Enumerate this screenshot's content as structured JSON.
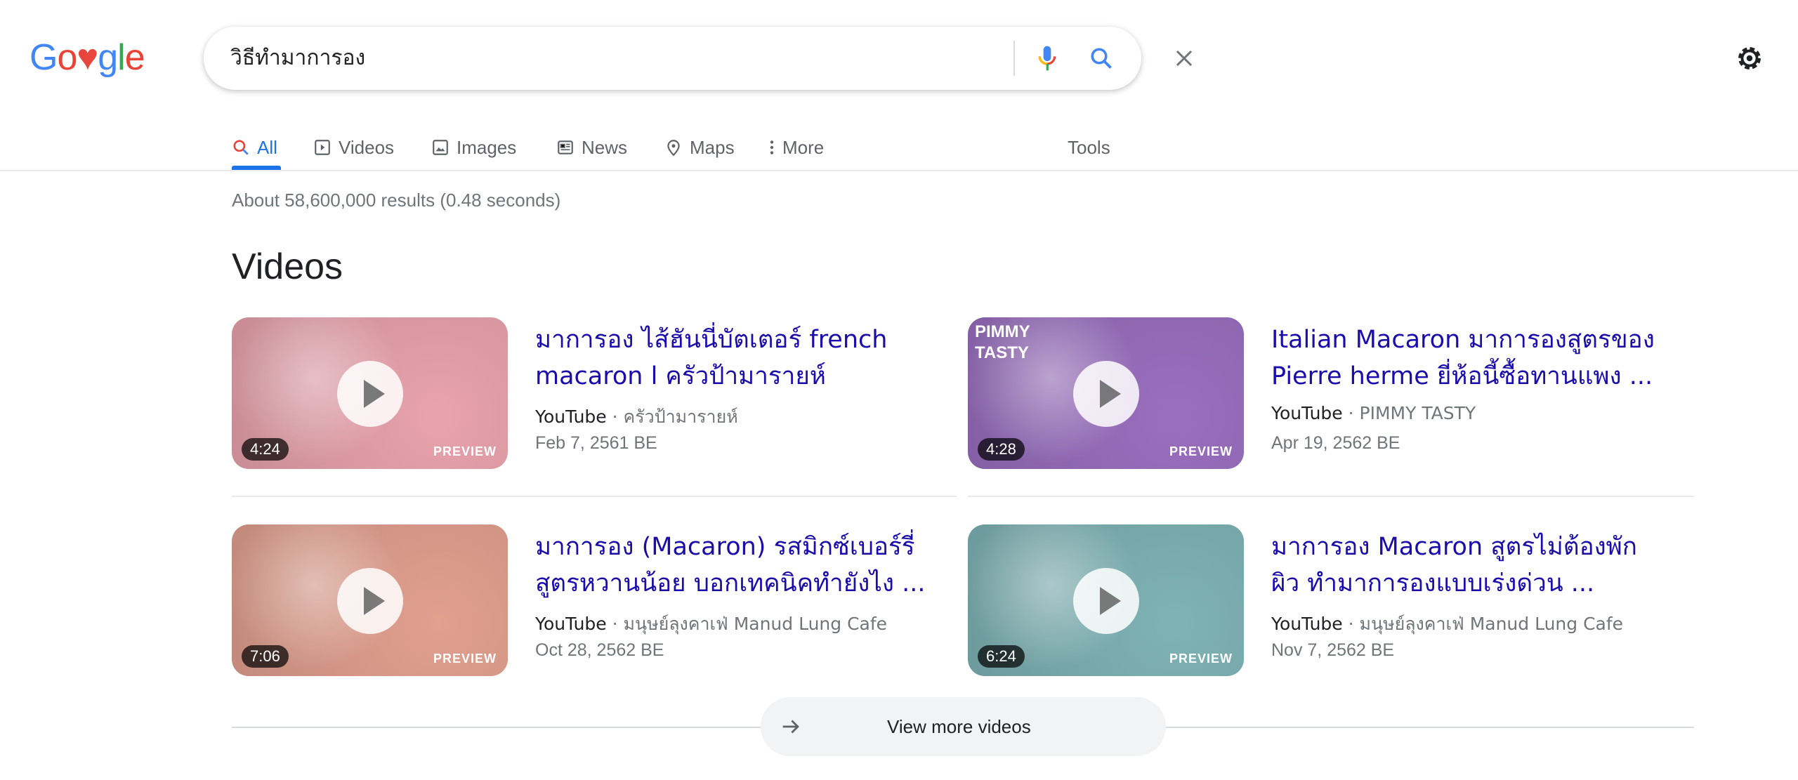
{
  "logo": {
    "text": "Google",
    "colors": [
      "#4285f4",
      "#ea4335",
      "#e8453c",
      "#4285f4",
      "#34a853",
      "#ea4335"
    ]
  },
  "search": {
    "query": "วิธีทำมาการอง",
    "clear_icon": "close-icon",
    "mic_icon": "mic-icon",
    "search_icon": "search-icon"
  },
  "settings_icon": "gear-icon",
  "tabs": [
    {
      "label": "All",
      "icon": "search-icon",
      "active": true
    },
    {
      "label": "Videos",
      "icon": "play-box-icon"
    },
    {
      "label": "Images",
      "icon": "image-icon"
    },
    {
      "label": "News",
      "icon": "news-icon"
    },
    {
      "label": "Maps",
      "icon": "map-pin-icon"
    },
    {
      "label": "More",
      "icon": "more-vert-icon"
    }
  ],
  "tools_label": "Tools",
  "result_stats": "About 58,600,000 results (0.48 seconds)",
  "videos": {
    "heading": "Videos",
    "items": [
      {
        "title": "มาการอง ไส้ฮันนี่บัตเตอร์ french macaron l ครัวป้ามารายห์",
        "source": "YouTube",
        "channel": "ครัวป้ามารายห์",
        "date": "Feb 7, 2561 BE",
        "duration": "4:24",
        "preview": "PREVIEW",
        "color": "#e9a3ad"
      },
      {
        "title": "Italian Macaron มาการองสูตรของ Pierre herme ยี่ห้อนี้ซื้อทานแพง ...",
        "source": "YouTube",
        "channel": "PIMMY TASTY",
        "date": "Apr 19, 2562 BE",
        "duration": "4:28",
        "preview": "PREVIEW",
        "color": "#9a6fbf",
        "thumb_text": "PIMMY TASTY"
      },
      {
        "title": "มาการอง (Macaron) รสมิกซ์เบอร์รี่ สูตรหวานน้อย บอกเทคนิคทำยังไง ...",
        "source": "YouTube",
        "channel": "มนุษย์ลุงคาเฟ่ Manud Lung Cafe",
        "date": "Oct 28, 2562 BE",
        "duration": "7:06",
        "preview": "PREVIEW",
        "color": "#e2a08f"
      },
      {
        "title": "มาการอง Macaron สูตรไม่ต้องพักผิว ทำมาการองแบบเร่งด่วน ...",
        "source": "YouTube",
        "channel": "มนุษย์ลุงคาเฟ่ Manud Lung Cafe",
        "date": "Nov 7, 2562 BE",
        "duration": "6:24",
        "preview": "PREVIEW",
        "color": "#7fb3b5"
      }
    ],
    "view_more": "View more videos"
  }
}
